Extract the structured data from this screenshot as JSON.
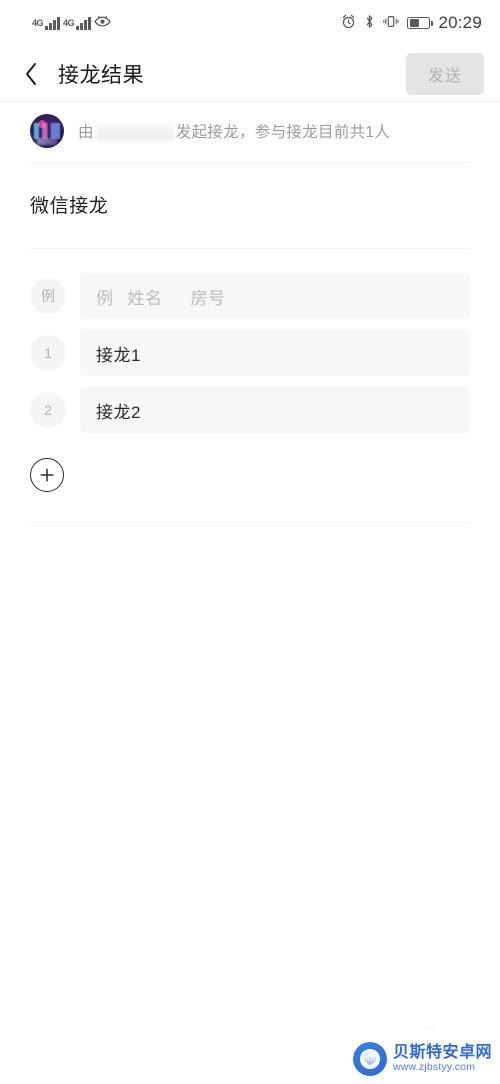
{
  "statusbar": {
    "network_label_1": "4G",
    "network_label_2": "4G",
    "eye_icon": "eye-icon",
    "alarm_icon": "alarm-clock-icon",
    "bluetooth_icon": "bluetooth-icon",
    "vibrate_icon": "vibrate-icon",
    "battery_icon": "battery-icon",
    "battery_level_percent": 52,
    "time": "20:29"
  },
  "navbar": {
    "back_icon": "back-chevron-icon",
    "title": "接龙结果",
    "send_label": "发送",
    "send_enabled": false
  },
  "info": {
    "avatar": "user-avatar",
    "prefix": "由",
    "redacted_name": "",
    "suffix": "发起接龙，参与接龙目前共1人",
    "participant_count": 1
  },
  "relay": {
    "title": "微信接龙"
  },
  "entries": [
    {
      "badge": "例",
      "value": "",
      "placeholder_a": "例",
      "placeholder_b": "姓名",
      "placeholder_c": "房号",
      "is_example": true
    },
    {
      "badge": "1",
      "value": "接龙1",
      "is_example": false
    },
    {
      "badge": "2",
      "value": "接龙2",
      "is_example": false
    }
  ],
  "add_button": {
    "icon": "plus-circle-icon",
    "label": ""
  },
  "watermark": {
    "logo_icon": "shell-logo-icon",
    "site_name": "贝斯特安卓网",
    "url": "www.zjbstyy.com",
    "ghost_mark": "∽"
  },
  "colors": {
    "page_bg": "#ffffff",
    "field_bg": "#f7f7f7",
    "badge_bg": "#f5f5f5",
    "send_disabled_bg": "#e4e4e4",
    "send_disabled_text": "#b4b4b4",
    "title_text": "#1a1a1a",
    "muted_text": "#9b9b9b",
    "divider": "#f2f2f2",
    "watermark_blue": "#2f6ad0"
  }
}
